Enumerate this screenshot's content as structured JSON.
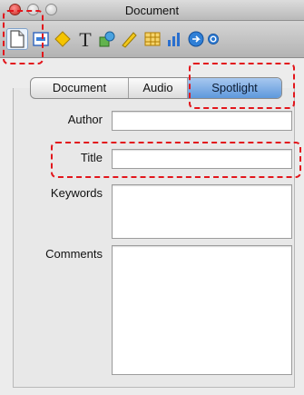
{
  "window": {
    "title": "Document"
  },
  "toolbar": {
    "tools": [
      {
        "name": "document-inspector-icon",
        "selected": true
      },
      {
        "name": "metrics-inspector-icon"
      },
      {
        "name": "graphic-inspector-icon"
      },
      {
        "name": "text-inspector-icon"
      },
      {
        "name": "shape-inspector-icon"
      },
      {
        "name": "ruler-inspector-icon"
      },
      {
        "name": "table-inspector-icon"
      },
      {
        "name": "chart-inspector-icon"
      },
      {
        "name": "link-inspector-icon"
      },
      {
        "name": "quicktime-inspector-icon"
      }
    ]
  },
  "tabs": [
    "Document",
    "Audio",
    "Spotlight"
  ],
  "active_tab": "Spotlight",
  "fields": {
    "author": {
      "label": "Author",
      "value": ""
    },
    "title": {
      "label": "Title",
      "value": ""
    },
    "keywords": {
      "label": "Keywords",
      "value": ""
    },
    "comments": {
      "label": "Comments",
      "value": ""
    }
  },
  "colors": {
    "highlight": "#e2161c",
    "active_tab": "#5e98dc"
  }
}
